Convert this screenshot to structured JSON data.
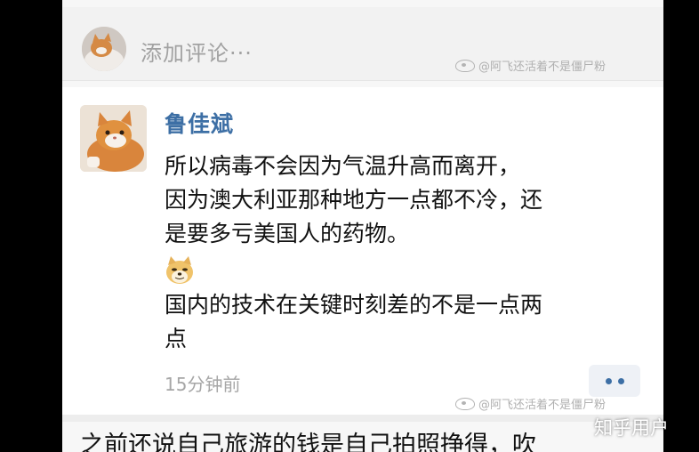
{
  "comment_input": {
    "placeholder": "添加评论···"
  },
  "watermark_top": "@阿飞还活着不是僵尸粉",
  "comment": {
    "username": "鲁佳斌",
    "lines": [
      "所以病毒不会因为气温升高而离开，",
      "因为澳大利亚那种地方一点都不冷，还",
      "是要多亏美国人的药物。"
    ],
    "emoji": "doge-emoji",
    "lines2": [
      "国内的技术在关键时刻差的不是一点两",
      "点"
    ],
    "time": "15分钟前"
  },
  "watermark_bottom": "@阿飞还活着不是僵尸粉",
  "next_comment_text": "之前还说自己旅游的钱是自己拍照挣得，吹",
  "zhihu_watermark": "知乎用户",
  "colors": {
    "username": "#3d6fa5",
    "placeholder": "#a2a2a2",
    "time": "#a6a6a6"
  }
}
